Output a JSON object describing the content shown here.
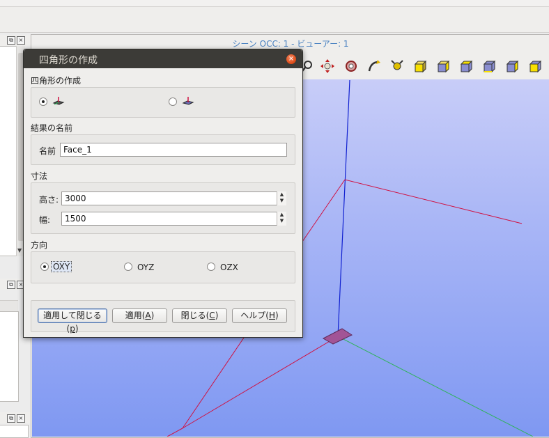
{
  "viewer": {
    "title": "シーン OCC: 1 - ビューアー: 1",
    "toolbar_icons": [
      "zoom-icon",
      "pan-icon",
      "rotate-icon",
      "global-pan-icon",
      "fit-all-icon",
      "view-front-icon",
      "view-back-icon",
      "view-top-icon",
      "view-bottom-icon",
      "view-left-icon",
      "view-right-icon"
    ]
  },
  "dialog": {
    "title": "四角形の作成",
    "close_glyph": "×",
    "section_type": "四角形の作成",
    "section_result": "結果の名前",
    "name_label": "名前",
    "name_value": "Face_1",
    "section_dims": "寸法",
    "height_label": "高さ:",
    "height_value": "3000",
    "width_label": "幅:",
    "width_value": "1500",
    "section_orient": "方向",
    "orient_oxy": "OXY",
    "orient_oyz": "OYZ",
    "orient_ozx": "OZX",
    "selected_orientation": "OXY",
    "btn_apply_close": "適用して閉じる(",
    "btn_apply_close_mnemonic": "p",
    "btn_apply": "適用(",
    "btn_apply_mnemonic": "A",
    "btn_close": "閉じる(",
    "btn_close_mnemonic": "C",
    "btn_help": "ヘルプ(",
    "btn_help_mnemonic": "H",
    "close_paren": ")"
  },
  "colors": {
    "dialog_titlebar": "#3c3b37",
    "close_button": "#dd4814",
    "viewer_title": "#4a82c1",
    "x_axis": "#d01040",
    "y_axis": "#2fb35a",
    "z_axis": "#1020d0",
    "face": "#a25496"
  }
}
